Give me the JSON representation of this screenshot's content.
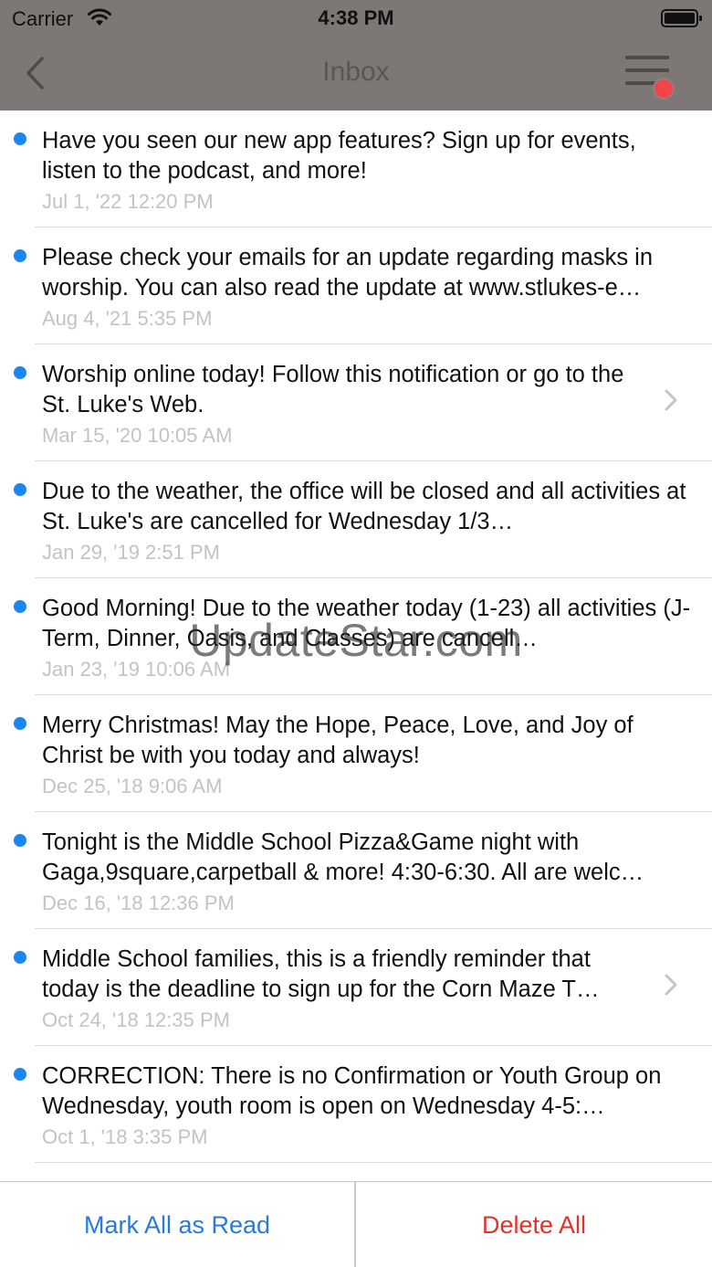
{
  "status_bar": {
    "carrier": "Carrier",
    "time": "4:38 PM"
  },
  "nav": {
    "title": "Inbox",
    "back_icon": "chevron-left-icon",
    "menu_icon": "hamburger-menu-icon"
  },
  "messages": [
    {
      "text": "Have you seen our new app features? Sign up for events, listen to the podcast, and more!",
      "date": "Jul 1, '22 12:20 PM",
      "unread": true,
      "chevron": false
    },
    {
      "text": "Please check your emails for an update regarding masks in worship. You can also read the update at www.stlukes-e…",
      "date": "Aug 4, '21 5:35 PM",
      "unread": true,
      "chevron": false
    },
    {
      "text": "Worship online today! Follow this notification or go to the St. Luke's Web.",
      "date": "Mar 15, '20 10:05 AM",
      "unread": true,
      "chevron": true
    },
    {
      "text": "Due to the weather, the office will be closed and all activities at St. Luke's are cancelled for Wednesday 1/3…",
      "date": "Jan 29, '19 2:51 PM",
      "unread": true,
      "chevron": false
    },
    {
      "text": "Good Morning! Due to the weather today (1-23) all activities (J-Term, Dinner, Oasis, and Classes) are cancell…",
      "date": "Jan 23, '19 10:06 AM",
      "unread": true,
      "chevron": false
    },
    {
      "text": "Merry Christmas! May the Hope, Peace, Love, and Joy of Christ be with you today and always!",
      "date": "Dec 25, '18 9:06 AM",
      "unread": true,
      "chevron": false
    },
    {
      "text": "Tonight is the Middle School Pizza&Game night with Gaga,9square,carpetball & more! 4:30-6:30. All are welc…",
      "date": "Dec 16, '18 12:36 PM",
      "unread": true,
      "chevron": false
    },
    {
      "text": "Middle School families, this is a friendly reminder that today is the deadline to sign up for the Corn Maze T…",
      "date": "Oct 24, '18 12:35 PM",
      "unread": true,
      "chevron": true
    },
    {
      "text": "CORRECTION: There is no Confirmation or Youth Group on Wednesday, youth room is open on Wednesday 4-5:…",
      "date": "Oct 1, '18 3:35 PM",
      "unread": true,
      "chevron": false
    }
  ],
  "watermark": "UpdateStar.com",
  "bottom": {
    "mark_all_read": "Mark All as Read",
    "delete_all": "Delete All"
  },
  "colors": {
    "header_bg": "#7d7875",
    "unread_dot": "#1b86f0",
    "badge": "#f2454a",
    "mark_read_text": "#2a7ad6",
    "delete_text": "#e0322d",
    "date_text": "#c3c3c7"
  }
}
